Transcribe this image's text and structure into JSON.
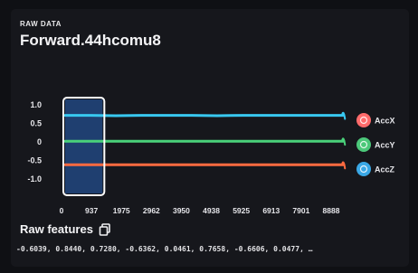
{
  "section_label": "RAW DATA",
  "sample_name": "Forward.44hcomu8",
  "raw_features": {
    "label": "Raw features",
    "values": "-0.6039, 0.8440, 0.7280, -0.6362, 0.0461, 0.7658, -0.6606, 0.0477, …"
  },
  "icons": {
    "copy": "copy-icon"
  },
  "chart_data": {
    "type": "line",
    "x_ticks": [
      "0",
      "937",
      "1975",
      "2962",
      "3950",
      "4938",
      "5925",
      "6913",
      "7901",
      "8888"
    ],
    "y_ticks": [
      "1.0",
      "0.5",
      "0",
      "-0.5",
      "-1.0"
    ],
    "x_range": [
      0,
      8888
    ],
    "y_range": [
      -1.2,
      1.2
    ],
    "grid": false,
    "legend_position": "right",
    "selection_window": [
      0,
      500
    ],
    "series": [
      {
        "name": "AccX",
        "color": "#38c8f0",
        "values": [
          0.72,
          0.72,
          0.71,
          0.72,
          0.72,
          0.72,
          0.71,
          0.72,
          0.72,
          0.72,
          0.72,
          0.72
        ]
      },
      {
        "name": "AccY",
        "color": "#4ad17a",
        "values": [
          0.02,
          0.02,
          0.02,
          0.02,
          0.02,
          0.02,
          0.02,
          0.02,
          0.02,
          0.02,
          0.02,
          0.02
        ]
      },
      {
        "name": "AccZ",
        "color": "#ff6a40",
        "values": [
          -0.62,
          -0.62,
          -0.62,
          -0.62,
          -0.62,
          -0.62,
          -0.62,
          -0.62,
          -0.62,
          -0.62,
          -0.62,
          -0.62
        ]
      }
    ],
    "legend_icon_colors": [
      "#ff6b6b",
      "#4cc87a",
      "#3aa8e6"
    ]
  }
}
